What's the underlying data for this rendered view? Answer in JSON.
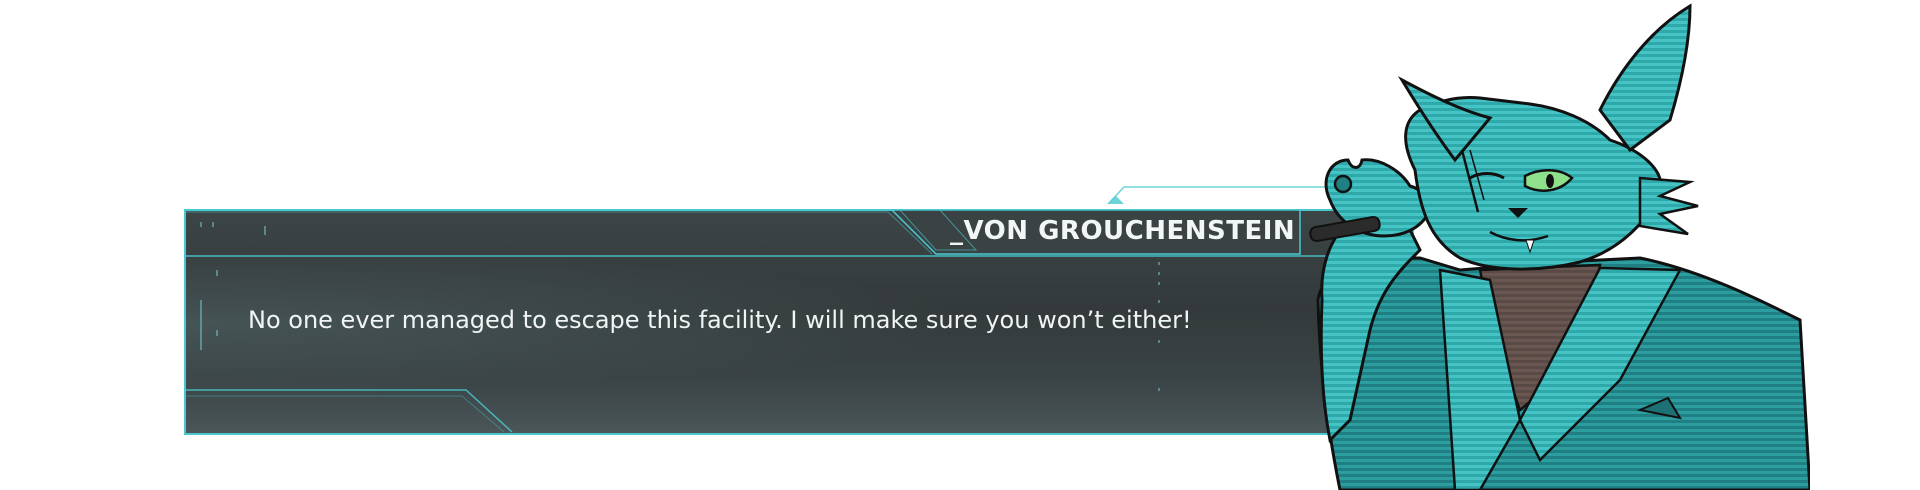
{
  "dialogue": {
    "speaker": "_VON GROUCHENSTEIN",
    "text": "No one ever managed to escape this facility. I will make sure you won’t either!"
  },
  "portrait": {
    "icon": "grumpy-cat-character-portrait-icon"
  },
  "colors": {
    "accent": "#49c9cf",
    "box_dark": "#343a3b",
    "portrait_teal": "#2fa6a8",
    "text": "#f0f4f4"
  }
}
